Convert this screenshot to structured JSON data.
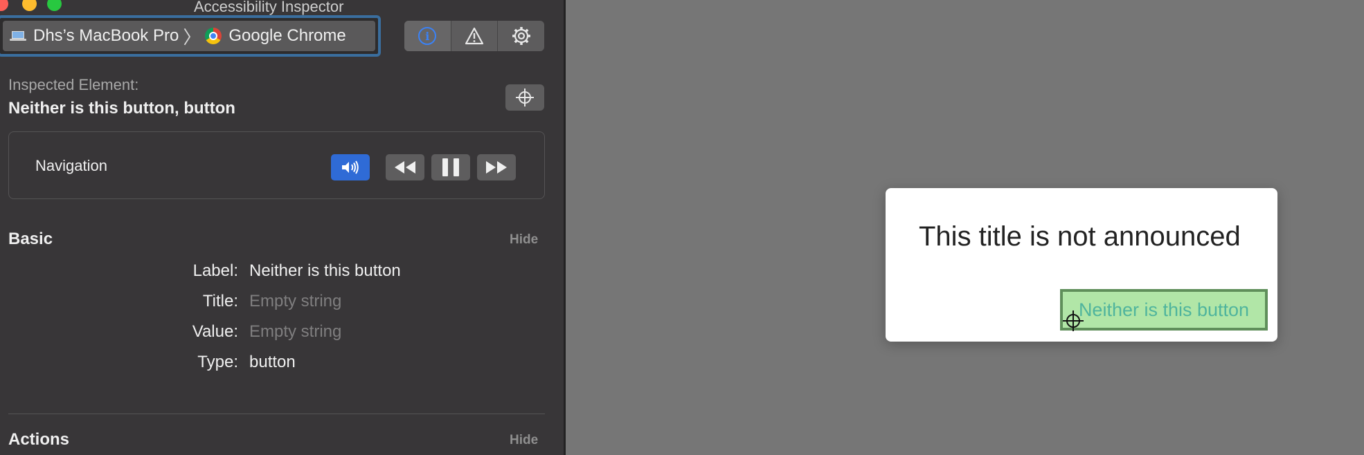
{
  "window": {
    "title": "Accessibility Inspector"
  },
  "target": {
    "device": "Dhs’s MacBook Pro",
    "app": "Google Chrome"
  },
  "toolbar": {
    "inspection_icon": "info-icon",
    "audit_icon": "warning-icon",
    "settings_icon": "gear-icon"
  },
  "inspected": {
    "label": "Inspected Element:",
    "name": "Neither is this button, button"
  },
  "navigation": {
    "label": "Navigation"
  },
  "basic": {
    "title": "Basic",
    "hide": "Hide",
    "rows": [
      {
        "key": "Label:",
        "value": "Neither is this button",
        "empty": false
      },
      {
        "key": "Title:",
        "value": "Empty string",
        "empty": true
      },
      {
        "key": "Value:",
        "value": "Empty string",
        "empty": true
      },
      {
        "key": "Type:",
        "value": "button",
        "empty": false
      }
    ]
  },
  "actions": {
    "title": "Actions",
    "hide": "Hide"
  },
  "web": {
    "dialog_title": "This title is not announced",
    "button_label": "Neither is this button"
  },
  "colors": {
    "accent": "#2f6bd6",
    "highlight_fill": "#b1e6a7",
    "highlight_border": "#5f8f5a"
  }
}
